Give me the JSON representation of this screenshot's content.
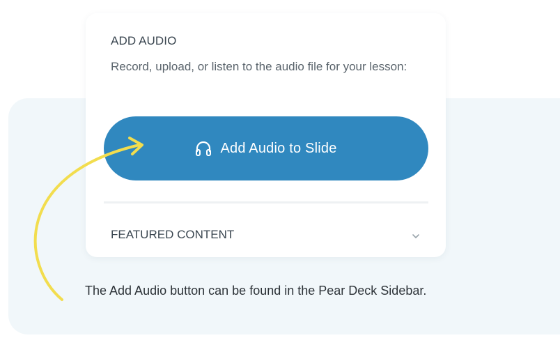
{
  "sidebar": {
    "section_title": "ADD AUDIO",
    "section_description": "Record, upload, or listen to the audio file for your lesson:",
    "add_audio_button": {
      "label": "Add Audio to Slide",
      "icon": "headphones-icon"
    },
    "featured_content": {
      "label": "FEATURED CONTENT",
      "icon": "chevron-down-icon"
    }
  },
  "caption": {
    "text": "The Add Audio button can be found in the Pear Deck Sidebar."
  },
  "colors": {
    "button": "#3088bf",
    "arrow": "#f2dd4e",
    "panel_background": "#f1f7fa"
  }
}
